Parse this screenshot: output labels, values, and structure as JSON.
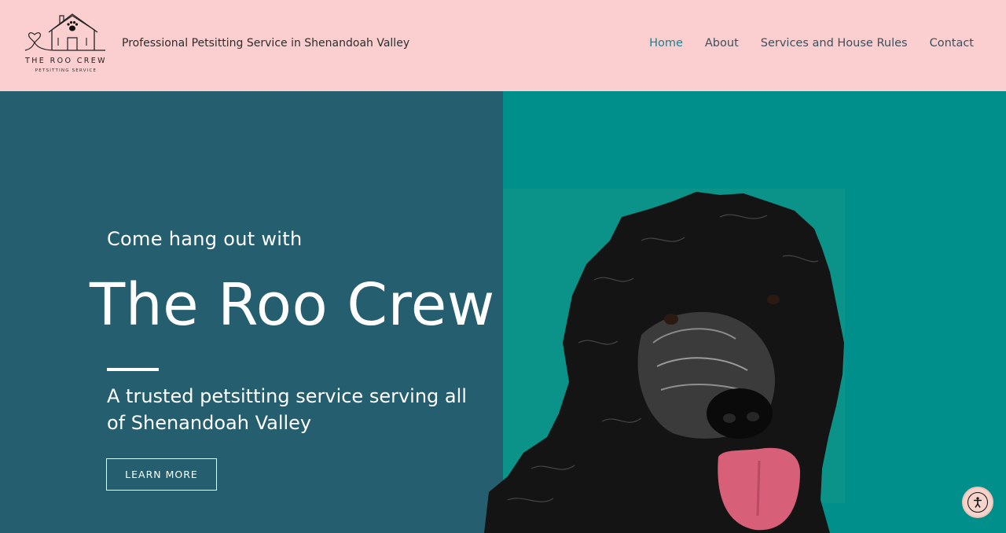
{
  "header": {
    "logo_name": "THE ROO CREW",
    "logo_sub": "PETSITTING SERVICE",
    "tagline": "Professional Petsitting Service in Shenandoah Valley",
    "nav": [
      {
        "label": "Home",
        "active": true
      },
      {
        "label": "About",
        "active": false
      },
      {
        "label": "Services and House Rules",
        "active": false
      },
      {
        "label": "Contact",
        "active": false
      }
    ]
  },
  "hero": {
    "kicker": "Come hang out with",
    "title": "The Roo Crew",
    "subtitle": "A trusted petsitting service serving all of Shenandoah Valley",
    "cta_label": "LEARN MORE",
    "image_icon": "black-dog-photo"
  },
  "widgets": {
    "accessibility_icon": "accessibility-icon"
  },
  "colors": {
    "header_bg": "#fbcfcf",
    "hero_left_bg": "#245e6f",
    "hero_right_bg": "#008f8a",
    "nav_active": "#1f7f8c",
    "nav_text": "#3d4f5c",
    "white": "#ffffff"
  }
}
